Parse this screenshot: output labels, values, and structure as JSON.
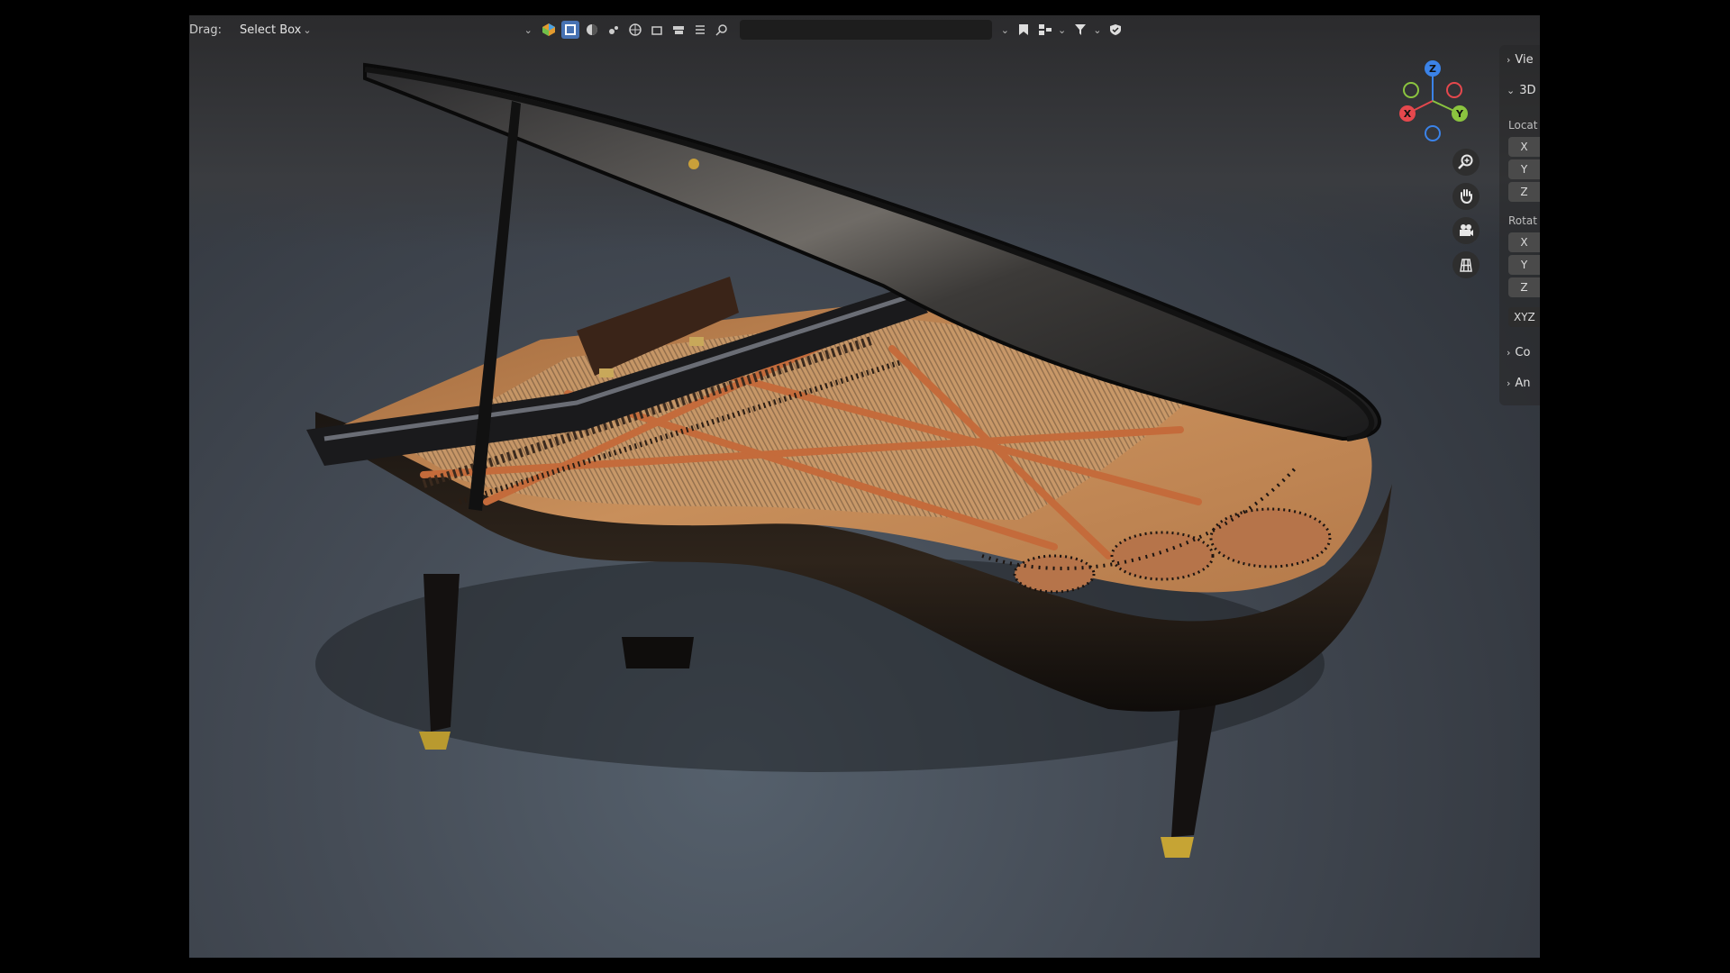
{
  "header": {
    "drag_label": "Drag:",
    "drag_mode": "Select Box",
    "search_placeholder": ""
  },
  "gizmo": {
    "z": "Z",
    "x": "X",
    "y": "Y"
  },
  "sidebar": {
    "panels": [
      {
        "label": "Vie",
        "expanded": false
      },
      {
        "label": "3D",
        "expanded": true
      },
      {
        "label": "Co",
        "expanded": false
      },
      {
        "label": "An",
        "expanded": false
      }
    ],
    "location_label": "Locat",
    "location_fields": [
      "X",
      "Y",
      "Z"
    ],
    "rotation_label": "Rotat",
    "rotation_fields": [
      "X",
      "Y",
      "Z"
    ],
    "rotation_mode": "XYZ"
  },
  "colors": {
    "accent": "#4772b3",
    "axis_x": "#e5484d",
    "axis_y": "#8bc43f",
    "axis_z": "#3b83e8"
  },
  "icons": {
    "zoom": "zoom-icon",
    "pan": "hand-icon",
    "camera": "camera-icon",
    "grid": "grid-icon"
  }
}
